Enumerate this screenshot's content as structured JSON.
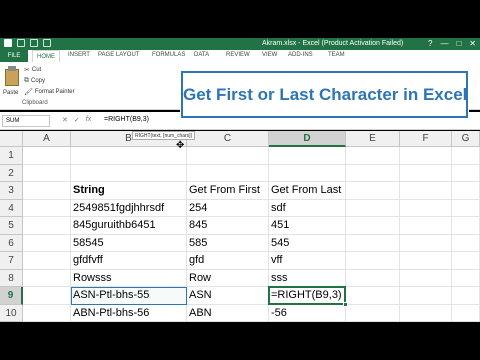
{
  "window": {
    "title": "Akram.xlsx - Excel (Product Activation Failed)",
    "controls": [
      "?",
      "—",
      "□",
      "✕"
    ]
  },
  "ribbon": {
    "tabs": [
      "FILE",
      "HOME",
      "INSERT",
      "PAGE LAYOUT",
      "FORMULAS",
      "DATA",
      "REVIEW",
      "VIEW",
      "ADD-INS",
      "TEAM"
    ],
    "paste_label": "Paste",
    "cut_label": "Cut",
    "copy_label": "Copy",
    "format_painter_label": "Format Painter",
    "clipboard_group": "Clipboard"
  },
  "formula_bar": {
    "name_box": "SUM",
    "fx_icons": [
      "✕",
      "✓",
      "fx"
    ],
    "formula": "=RIGHT(B9,3)",
    "tooltip": "RIGHT(text, [num_chars])"
  },
  "banner": {
    "text": "Get First or Last Character in Excel",
    "color": "#2e75b6"
  },
  "sheet": {
    "columns": [
      "A",
      "B",
      "C",
      "D",
      "E",
      "F",
      "G"
    ],
    "active_column": "D",
    "active_row": "9",
    "rows": [
      {
        "num": "1",
        "b": "",
        "c": "",
        "d": ""
      },
      {
        "num": "2",
        "b": "",
        "c": "",
        "d": ""
      },
      {
        "num": "3",
        "b": "String",
        "c": "Get From First",
        "d": "Get From Last"
      },
      {
        "num": "4",
        "b": "2549851fgdjhhrsdf",
        "c": "254",
        "d": "sdf"
      },
      {
        "num": "5",
        "b": "845guruithb6451",
        "c": "845",
        "d": "451"
      },
      {
        "num": "6",
        "b": "58545",
        "c": "585",
        "d": "545"
      },
      {
        "num": "7",
        "b": "gfdfvff",
        "c": "gfd",
        "d": "vff"
      },
      {
        "num": "8",
        "b": "Rowsss",
        "c": "Row",
        "d": "sss"
      },
      {
        "num": "9",
        "b": "ASN-Ptl-bhs-55",
        "c": "ASN",
        "d": "=RIGHT(B9,3)"
      },
      {
        "num": "10",
        "b": "ABN-Ptl-bhs-56",
        "c": "ABN",
        "d": "-56"
      }
    ],
    "accent_color": "#217346"
  }
}
